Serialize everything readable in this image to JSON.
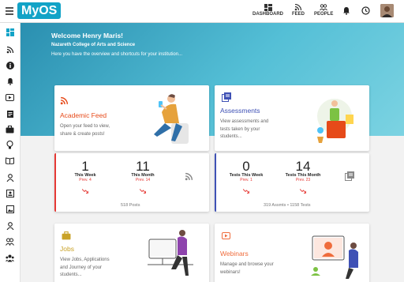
{
  "app": {
    "logo": "MyOS"
  },
  "nav": {
    "dashboard": "DASHBOARD",
    "feed": "FEED",
    "people": "PEOPLE"
  },
  "banner": {
    "welcome": "Welcome Henry Maris!",
    "institution": "Nazareth College of Arts and Science",
    "subtitle": "Here you have the overview and shortcuts for your institution..."
  },
  "cards": {
    "feed": {
      "title": "Academic Feed",
      "desc1": "Open your feed to view,",
      "desc2": "share & create posts!"
    },
    "assessments": {
      "title": "Assessments",
      "desc1": "View assessments and",
      "desc2": "tests taken by your",
      "desc3": "students..."
    },
    "jobs": {
      "title": "Jobs",
      "desc1": "View Jobs, Applications",
      "desc2": "and Journey of your",
      "desc3": "students..."
    },
    "webinars": {
      "title": "Webinars",
      "desc1": "Manage and browse your",
      "desc2": "webinars!"
    }
  },
  "stats": {
    "posts": {
      "week_value": "1",
      "week_label": "This Week",
      "week_prev": "Prev. 4",
      "month_value": "11",
      "month_label": "This Month",
      "month_prev": "Prev. 14",
      "footer": "518 Posts"
    },
    "tests": {
      "week_value": "0",
      "week_label": "Tests This Week",
      "week_prev": "Prev. 1",
      "month_value": "14",
      "month_label": "Tests This Month",
      "month_prev": "Prev. 23",
      "footer": "319 Assmts • 1158 Tests"
    }
  },
  "colors": {
    "accent": "#12a3c7",
    "feed": "#e64a19",
    "assess": "#3f51b5",
    "jobs": "#c9a227",
    "webinar": "#ef6c3c",
    "down": "#e53935"
  }
}
